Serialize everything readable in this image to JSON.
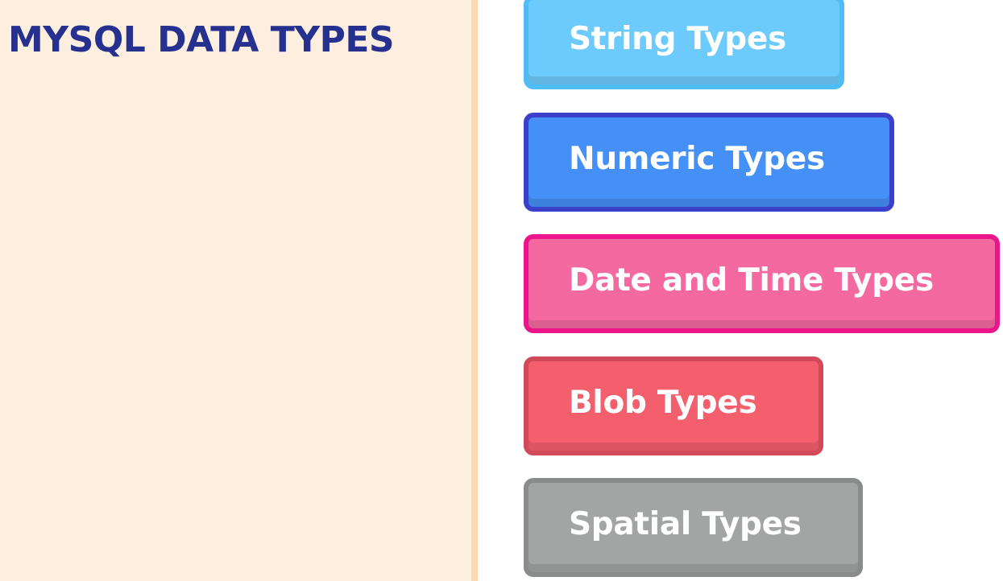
{
  "title": "MYSQL DATA TYPES",
  "data_types": [
    {
      "label": "String Types",
      "fill": "#6ccbfc",
      "border": "#4fbcf5"
    },
    {
      "label": "Numeric Types",
      "fill": "#4590f7",
      "border": "#3b3fcc"
    },
    {
      "label": "Date and Time Types",
      "fill": "#f46aa0",
      "border": "#ec168c"
    },
    {
      "label": "Blob Types",
      "fill": "#f45f6e",
      "border": "#d24a5a"
    },
    {
      "label": "Spatial Types",
      "fill": "#a3a5a4",
      "border": "#8a8c8b"
    }
  ],
  "colors": {
    "title": "#25308f",
    "left_panel": "#fcefdf",
    "divider": "#fcd9b0",
    "background": "#ffffff"
  }
}
